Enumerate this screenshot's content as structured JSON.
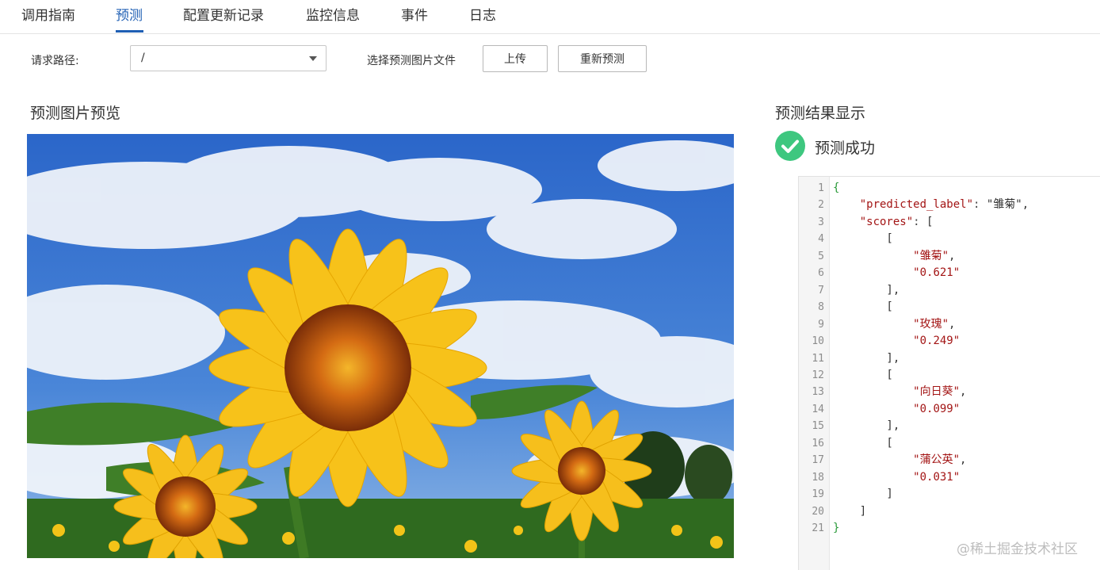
{
  "tabs": [
    {
      "label": "调用指南",
      "active": false
    },
    {
      "label": "预测",
      "active": true
    },
    {
      "label": "配置更新记录",
      "active": false
    },
    {
      "label": "监控信息",
      "active": false
    },
    {
      "label": "事件",
      "active": false
    },
    {
      "label": "日志",
      "active": false
    }
  ],
  "toolbar": {
    "path_label": "请求路径:",
    "path_value": "/",
    "file_label": "选择预测图片文件",
    "upload_label": "上传",
    "repredict_label": "重新预测"
  },
  "preview": {
    "title": "预测图片预览"
  },
  "result": {
    "title": "预测结果显示",
    "status": "预测成功",
    "status_color": "#3ec77f",
    "code_lines": [
      {
        "n": "1",
        "text": "{"
      },
      {
        "n": "2",
        "text": "    \"predicted_label\": \"雏菊\","
      },
      {
        "n": "3",
        "text": "    \"scores\": ["
      },
      {
        "n": "4",
        "text": "        ["
      },
      {
        "n": "5",
        "text": "            \"雏菊\","
      },
      {
        "n": "6",
        "text": "            \"0.621\""
      },
      {
        "n": "7",
        "text": "        ],"
      },
      {
        "n": "8",
        "text": "        ["
      },
      {
        "n": "9",
        "text": "            \"玫瑰\","
      },
      {
        "n": "10",
        "text": "            \"0.249\""
      },
      {
        "n": "11",
        "text": "        ],"
      },
      {
        "n": "12",
        "text": "        ["
      },
      {
        "n": "13",
        "text": "            \"向日葵\","
      },
      {
        "n": "14",
        "text": "            \"0.099\""
      },
      {
        "n": "15",
        "text": "        ],"
      },
      {
        "n": "16",
        "text": "        ["
      },
      {
        "n": "17",
        "text": "            \"蒲公英\","
      },
      {
        "n": "18",
        "text": "            \"0.031\""
      },
      {
        "n": "19",
        "text": "        ]"
      },
      {
        "n": "20",
        "text": "    ]"
      },
      {
        "n": "21",
        "text": "}"
      }
    ]
  },
  "watermark": "@稀土掘金技术社区",
  "colors": {
    "accent": "#1f5fb4",
    "success": "#3ec77f",
    "json_string": "#a31515"
  }
}
